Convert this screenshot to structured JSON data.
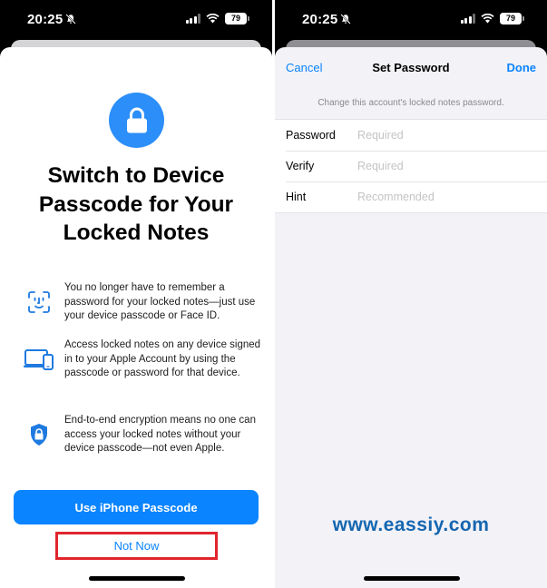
{
  "left_screen": {
    "status": {
      "time": "20:25",
      "battery": "79"
    },
    "headline": "Switch to Device\nPasscode for Your\nLocked Notes",
    "features": [
      {
        "icon": "face-id-icon",
        "text": "You no longer have to remember a password for your locked notes—just use your device passcode or Face ID."
      },
      {
        "icon": "devices-icon",
        "text": "Access locked notes on any device signed in to your Apple Account by using the passcode or password for that device."
      },
      {
        "icon": "shield-lock-icon",
        "text": "End-to-end encryption means no one can access your locked notes without your device passcode—not even Apple."
      }
    ],
    "primary_button": "Use iPhone Passcode",
    "secondary_button": "Not Now"
  },
  "right_screen": {
    "status": {
      "time": "20:25",
      "battery": "79"
    },
    "nav": {
      "cancel": "Cancel",
      "title": "Set Password",
      "done": "Done"
    },
    "hint": "Change this account's locked notes password.",
    "fields": [
      {
        "label": "Password",
        "placeholder": "Required"
      },
      {
        "label": "Verify",
        "placeholder": "Required"
      },
      {
        "label": "Hint",
        "placeholder": "Recommended"
      }
    ],
    "watermark": "www.eassiy.com"
  },
  "colors": {
    "accent": "#0a84ff",
    "highlight_border": "#e0252c",
    "watermark": "#1566b0"
  }
}
